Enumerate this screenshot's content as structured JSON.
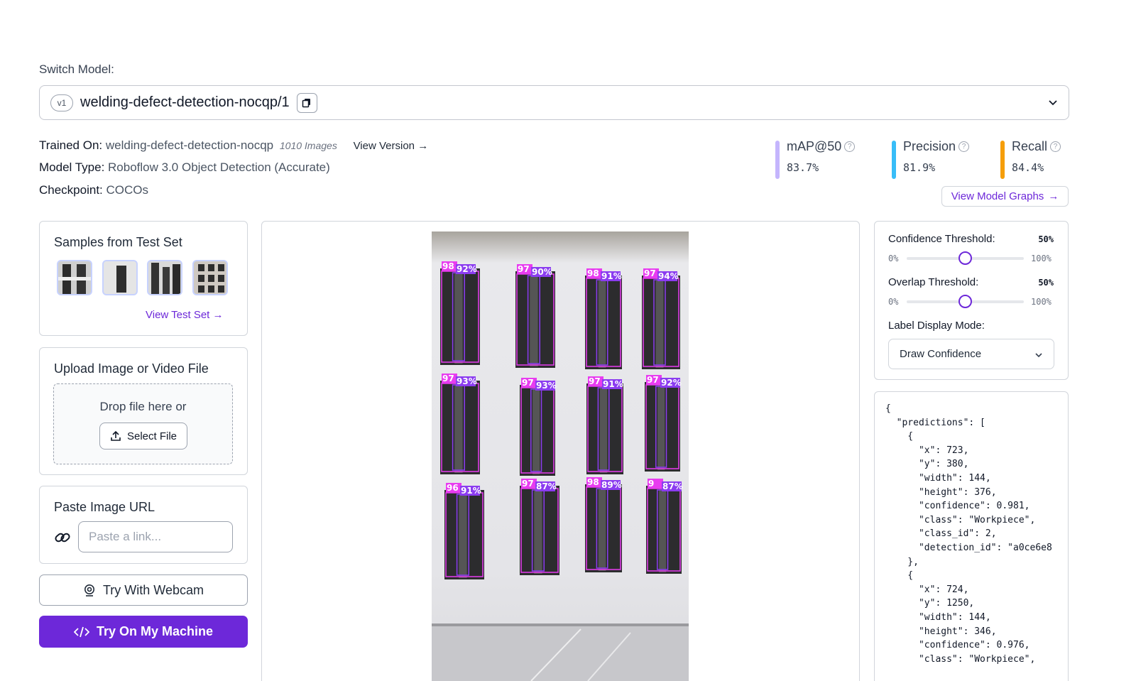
{
  "switch_model": {
    "label": "Switch Model:",
    "version_badge": "v1",
    "model_id": "welding-defect-detection-nocqp/1"
  },
  "model_info": {
    "trained_on_label": "Trained On:",
    "trained_on_value": "welding-defect-detection-nocqp",
    "image_count": "1010 Images",
    "view_version": "View Version",
    "model_type_label": "Model Type:",
    "model_type_value": "Roboflow 3.0 Object Detection (Accurate)",
    "checkpoint_label": "Checkpoint:",
    "checkpoint_value": "COCOs"
  },
  "metrics": [
    {
      "label": "mAP@50",
      "value": "83.7%",
      "color": "#c4b5fd"
    },
    {
      "label": "Precision",
      "value": "81.9%",
      "color": "#38bdf8"
    },
    {
      "label": "Recall",
      "value": "84.4%",
      "color": "#f59e0b"
    }
  ],
  "view_model_graphs": "View Model Graphs",
  "samples": {
    "title": "Samples from Test Set",
    "view_test_set": "View Test Set"
  },
  "upload": {
    "title": "Upload Image or Video File",
    "drop_text": "Drop file here or",
    "select_file": "Select File"
  },
  "paste_url": {
    "title": "Paste Image URL",
    "placeholder": "Paste a link..."
  },
  "webcam_button": "Try With Webcam",
  "machine_button": "Try On My Machine",
  "controls": {
    "confidence_label": "Confidence Threshold:",
    "confidence_value": "50%",
    "confidence_level": 0.5,
    "overlap_label": "Overlap Threshold:",
    "overlap_value": "50%",
    "overlap_level": 0.5,
    "range_min": "0%",
    "range_max": "100%",
    "label_mode_label": "Label Display Mode:",
    "label_mode_value": "Draw Confidence"
  },
  "detections": {
    "colors": {
      "workpiece": "#e83cf0",
      "weld": "#8b3cf0"
    },
    "items": [
      {
        "label_a": "98",
        "label_b": "92%"
      },
      {
        "label_a": "97",
        "label_b": "90%"
      },
      {
        "label_a": "98",
        "label_b": "91%"
      },
      {
        "label_a": "97",
        "label_b": "94%"
      },
      {
        "label_a": "97",
        "label_b": "93%"
      },
      {
        "label_a": "97",
        "label_b": "93%"
      },
      {
        "label_a": "97",
        "label_b": "91%"
      },
      {
        "label_a": "97",
        "label_b": "92%"
      },
      {
        "label_a": "96",
        "label_b": "91%"
      },
      {
        "label_a": "97",
        "label_b": "87%"
      },
      {
        "label_a": "98",
        "label_b": "89%"
      },
      {
        "label_a": "9",
        "label_b": "87%"
      }
    ]
  },
  "json_output": "{\n  \"predictions\": [\n    {\n      \"x\": 723,\n      \"y\": 380,\n      \"width\": 144,\n      \"height\": 376,\n      \"confidence\": 0.981,\n      \"class\": \"Workpiece\",\n      \"class_id\": 2,\n      \"detection_id\": \"a0ce6e8\n    },\n    {\n      \"x\": 724,\n      \"y\": 1250,\n      \"width\": 144,\n      \"height\": 346,\n      \"confidence\": 0.976,\n      \"class\": \"Workpiece\","
}
